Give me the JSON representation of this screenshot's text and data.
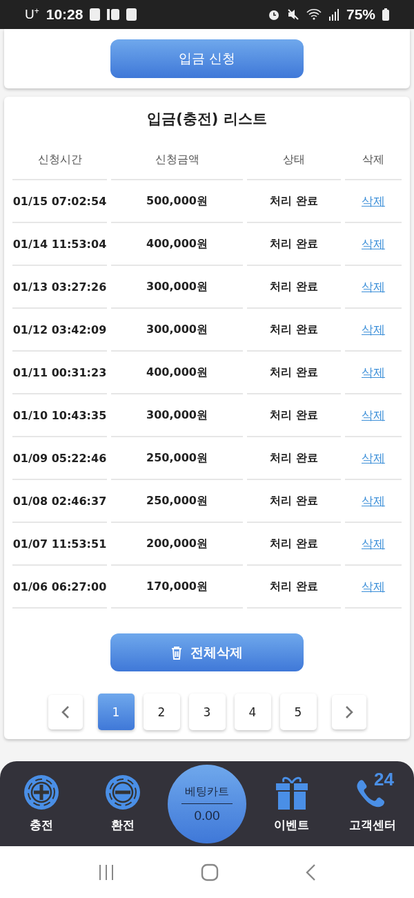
{
  "status_bar": {
    "carrier": "U$^{+}$",
    "time": "10:28",
    "battery": "75%"
  },
  "request_button": "입금 신청",
  "list": {
    "title": "입금(충전) 리스트",
    "columns": [
      "신청시간",
      "신청금액",
      "상태",
      "삭제"
    ],
    "rows": [
      {
        "time": "01/15 07:02:54",
        "amount": "500,000원",
        "status": "처리 완료",
        "action": "삭제"
      },
      {
        "time": "01/14 11:53:04",
        "amount": "400,000원",
        "status": "처리 완료",
        "action": "삭제"
      },
      {
        "time": "01/13 03:27:26",
        "amount": "300,000원",
        "status": "처리 완료",
        "action": "삭제"
      },
      {
        "time": "01/12 03:42:09",
        "amount": "300,000원",
        "status": "처리 완료",
        "action": "삭제"
      },
      {
        "time": "01/11 00:31:23",
        "amount": "400,000원",
        "status": "처리 완료",
        "action": "삭제"
      },
      {
        "time": "01/10 10:43:35",
        "amount": "300,000원",
        "status": "처리 완료",
        "action": "삭제"
      },
      {
        "time": "01/09 05:22:46",
        "amount": "250,000원",
        "status": "처리 완료",
        "action": "삭제"
      },
      {
        "time": "01/08 02:46:37",
        "amount": "250,000원",
        "status": "처리 완료",
        "action": "삭제"
      },
      {
        "time": "01/07 11:53:51",
        "amount": "200,000원",
        "status": "처리 완료",
        "action": "삭제"
      },
      {
        "time": "01/06 06:27:00",
        "amount": "170,000원",
        "status": "처리 완료",
        "action": "삭제"
      }
    ],
    "delete_all": "전체삭제"
  },
  "pagination": {
    "pages": [
      {
        "label": "1",
        "selected": true
      },
      {
        "label": "2",
        "selected": false
      },
      {
        "label": "3",
        "selected": false
      },
      {
        "label": "4",
        "selected": false
      },
      {
        "label": "5",
        "selected": false
      }
    ]
  },
  "bottom_nav": {
    "items": [
      {
        "label": "충전",
        "kind": "plus"
      },
      {
        "label": "환전",
        "kind": "minus"
      },
      {
        "label": "이벤트",
        "kind": "gift"
      },
      {
        "label": "고객센터",
        "kind": "phone",
        "badge": "24"
      }
    ],
    "betting_cart": {
      "title": "베팅카트",
      "amount": "0.00"
    }
  }
}
